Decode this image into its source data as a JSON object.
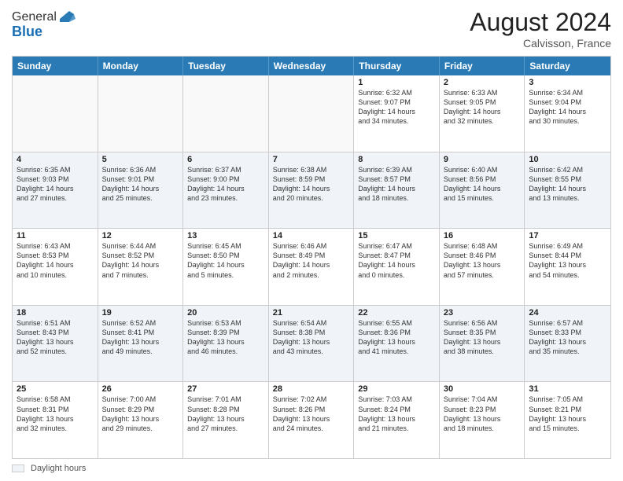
{
  "header": {
    "logo_line1": "General",
    "logo_line2": "Blue",
    "month_year": "August 2024",
    "location": "Calvisson, France"
  },
  "footer": {
    "legend_label": "Daylight hours"
  },
  "calendar": {
    "weekdays": [
      "Sunday",
      "Monday",
      "Tuesday",
      "Wednesday",
      "Thursday",
      "Friday",
      "Saturday"
    ],
    "rows": [
      [
        {
          "day": "",
          "info": ""
        },
        {
          "day": "",
          "info": ""
        },
        {
          "day": "",
          "info": ""
        },
        {
          "day": "",
          "info": ""
        },
        {
          "day": "1",
          "info": "Sunrise: 6:32 AM\nSunset: 9:07 PM\nDaylight: 14 hours\nand 34 minutes."
        },
        {
          "day": "2",
          "info": "Sunrise: 6:33 AM\nSunset: 9:05 PM\nDaylight: 14 hours\nand 32 minutes."
        },
        {
          "day": "3",
          "info": "Sunrise: 6:34 AM\nSunset: 9:04 PM\nDaylight: 14 hours\nand 30 minutes."
        }
      ],
      [
        {
          "day": "4",
          "info": "Sunrise: 6:35 AM\nSunset: 9:03 PM\nDaylight: 14 hours\nand 27 minutes."
        },
        {
          "day": "5",
          "info": "Sunrise: 6:36 AM\nSunset: 9:01 PM\nDaylight: 14 hours\nand 25 minutes."
        },
        {
          "day": "6",
          "info": "Sunrise: 6:37 AM\nSunset: 9:00 PM\nDaylight: 14 hours\nand 23 minutes."
        },
        {
          "day": "7",
          "info": "Sunrise: 6:38 AM\nSunset: 8:59 PM\nDaylight: 14 hours\nand 20 minutes."
        },
        {
          "day": "8",
          "info": "Sunrise: 6:39 AM\nSunset: 8:57 PM\nDaylight: 14 hours\nand 18 minutes."
        },
        {
          "day": "9",
          "info": "Sunrise: 6:40 AM\nSunset: 8:56 PM\nDaylight: 14 hours\nand 15 minutes."
        },
        {
          "day": "10",
          "info": "Sunrise: 6:42 AM\nSunset: 8:55 PM\nDaylight: 14 hours\nand 13 minutes."
        }
      ],
      [
        {
          "day": "11",
          "info": "Sunrise: 6:43 AM\nSunset: 8:53 PM\nDaylight: 14 hours\nand 10 minutes."
        },
        {
          "day": "12",
          "info": "Sunrise: 6:44 AM\nSunset: 8:52 PM\nDaylight: 14 hours\nand 7 minutes."
        },
        {
          "day": "13",
          "info": "Sunrise: 6:45 AM\nSunset: 8:50 PM\nDaylight: 14 hours\nand 5 minutes."
        },
        {
          "day": "14",
          "info": "Sunrise: 6:46 AM\nSunset: 8:49 PM\nDaylight: 14 hours\nand 2 minutes."
        },
        {
          "day": "15",
          "info": "Sunrise: 6:47 AM\nSunset: 8:47 PM\nDaylight: 14 hours\nand 0 minutes."
        },
        {
          "day": "16",
          "info": "Sunrise: 6:48 AM\nSunset: 8:46 PM\nDaylight: 13 hours\nand 57 minutes."
        },
        {
          "day": "17",
          "info": "Sunrise: 6:49 AM\nSunset: 8:44 PM\nDaylight: 13 hours\nand 54 minutes."
        }
      ],
      [
        {
          "day": "18",
          "info": "Sunrise: 6:51 AM\nSunset: 8:43 PM\nDaylight: 13 hours\nand 52 minutes."
        },
        {
          "day": "19",
          "info": "Sunrise: 6:52 AM\nSunset: 8:41 PM\nDaylight: 13 hours\nand 49 minutes."
        },
        {
          "day": "20",
          "info": "Sunrise: 6:53 AM\nSunset: 8:39 PM\nDaylight: 13 hours\nand 46 minutes."
        },
        {
          "day": "21",
          "info": "Sunrise: 6:54 AM\nSunset: 8:38 PM\nDaylight: 13 hours\nand 43 minutes."
        },
        {
          "day": "22",
          "info": "Sunrise: 6:55 AM\nSunset: 8:36 PM\nDaylight: 13 hours\nand 41 minutes."
        },
        {
          "day": "23",
          "info": "Sunrise: 6:56 AM\nSunset: 8:35 PM\nDaylight: 13 hours\nand 38 minutes."
        },
        {
          "day": "24",
          "info": "Sunrise: 6:57 AM\nSunset: 8:33 PM\nDaylight: 13 hours\nand 35 minutes."
        }
      ],
      [
        {
          "day": "25",
          "info": "Sunrise: 6:58 AM\nSunset: 8:31 PM\nDaylight: 13 hours\nand 32 minutes."
        },
        {
          "day": "26",
          "info": "Sunrise: 7:00 AM\nSunset: 8:29 PM\nDaylight: 13 hours\nand 29 minutes."
        },
        {
          "day": "27",
          "info": "Sunrise: 7:01 AM\nSunset: 8:28 PM\nDaylight: 13 hours\nand 27 minutes."
        },
        {
          "day": "28",
          "info": "Sunrise: 7:02 AM\nSunset: 8:26 PM\nDaylight: 13 hours\nand 24 minutes."
        },
        {
          "day": "29",
          "info": "Sunrise: 7:03 AM\nSunset: 8:24 PM\nDaylight: 13 hours\nand 21 minutes."
        },
        {
          "day": "30",
          "info": "Sunrise: 7:04 AM\nSunset: 8:23 PM\nDaylight: 13 hours\nand 18 minutes."
        },
        {
          "day": "31",
          "info": "Sunrise: 7:05 AM\nSunset: 8:21 PM\nDaylight: 13 hours\nand 15 minutes."
        }
      ]
    ]
  }
}
